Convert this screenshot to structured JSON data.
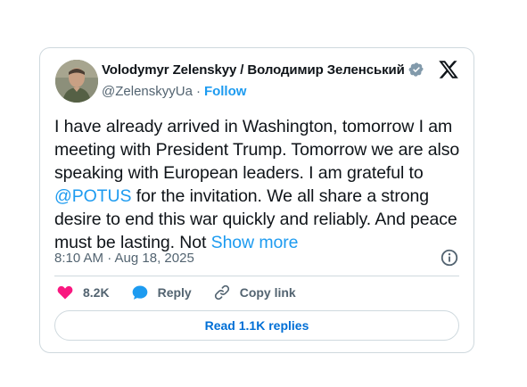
{
  "tweet": {
    "author": {
      "name": "Volodymyr Zelenskyy / Володимир Зеленський",
      "handle": "@ZelenskyyUa",
      "separator": "·",
      "follow_label": "Follow"
    },
    "text": {
      "before_mention": "I have already arrived in Washington, tomorrow I am meeting with President Trump. Tomorrow we are also speaking with European leaders. I am grateful to ",
      "mention": "@POTUS",
      "after_mention": " for the invitation. We all share a strong desire to end this war quickly and reliably. And peace must be lasting. Not ",
      "show_more": "Show more"
    },
    "timestamp": "8:10 AM · Aug 18, 2025",
    "actions": {
      "likes_count": "8.2K",
      "reply_label": "Reply",
      "copy_link_label": "Copy link"
    },
    "read_replies_label": "Read 1.1K replies"
  },
  "icons": {
    "verified": "verified-badge-icon",
    "logo": "x-logo-icon",
    "info": "info-icon",
    "like": "heart-icon",
    "reply": "speech-bubble-icon",
    "copy_link": "link-icon"
  },
  "colors": {
    "accent": "#1d9bf0",
    "like": "#f91880",
    "text": "#0f1419",
    "muted": "#536471",
    "border": "#cfd9de"
  }
}
